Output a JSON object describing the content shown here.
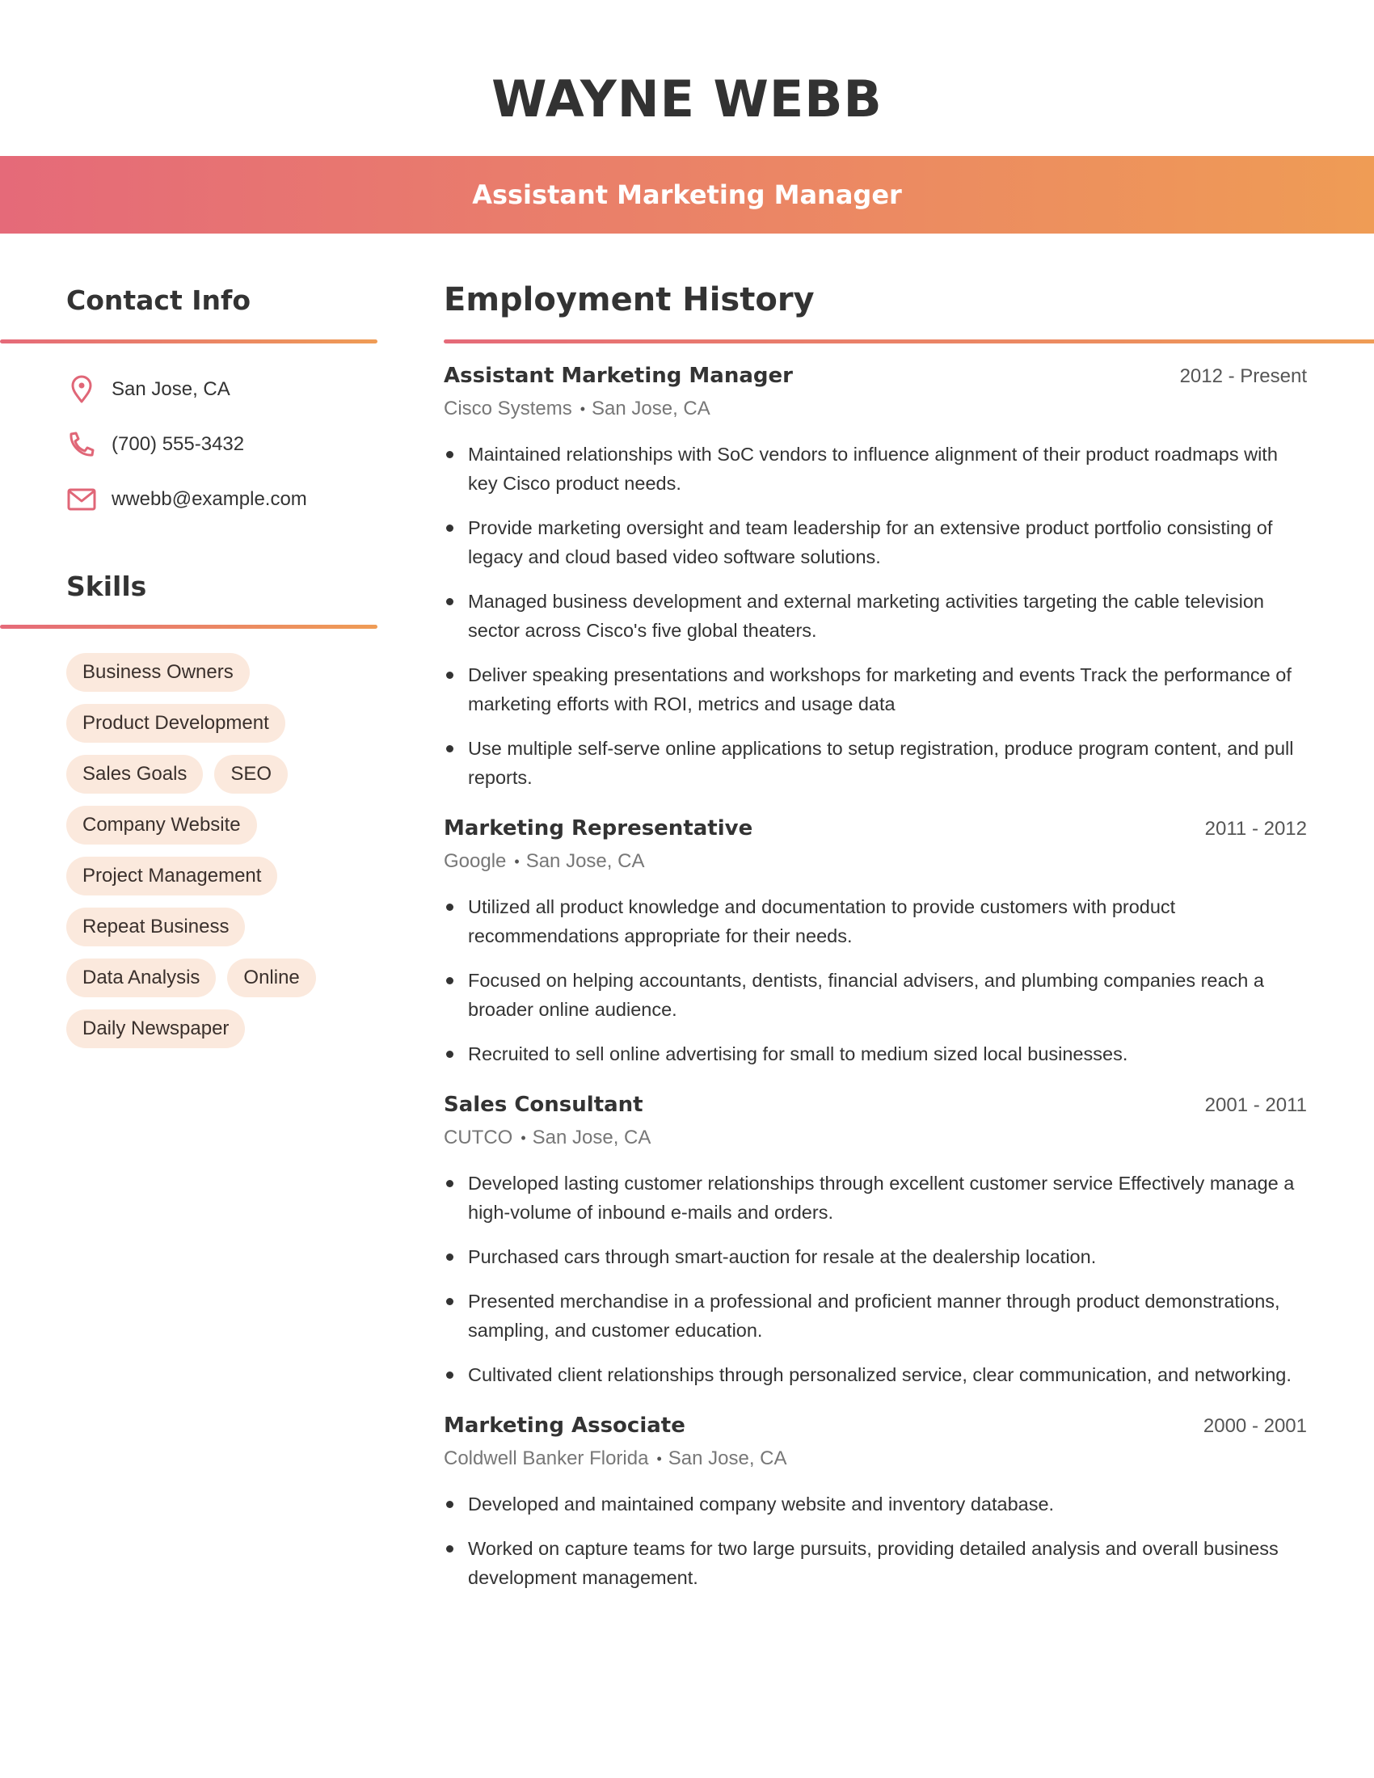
{
  "header": {
    "name": "WAYNE WEBB",
    "title": "Assistant Marketing Manager"
  },
  "colors": {
    "gradient_start": "#e56a79",
    "gradient_end": "#ef9c55",
    "icon": "#e06677",
    "chip_bg": "#fbe9dd",
    "text": "#333333"
  },
  "contact": {
    "heading": "Contact Info",
    "items": [
      {
        "icon": "location-pin-icon",
        "text": "San Jose, CA"
      },
      {
        "icon": "phone-icon",
        "text": "(700) 555-3432"
      },
      {
        "icon": "mail-icon",
        "text": "wwebb@example.com"
      }
    ]
  },
  "skills": {
    "heading": "Skills",
    "items": [
      "Business Owners",
      "Product Development",
      "Sales Goals",
      "SEO",
      "Company Website",
      "Project Management",
      "Repeat Business",
      "Data Analysis",
      "Online",
      "Daily Newspaper"
    ]
  },
  "employment": {
    "heading": "Employment History",
    "jobs": [
      {
        "title": "Assistant Marketing Manager",
        "dates": "2012 - Present",
        "company": "Cisco Systems",
        "location": "San Jose, CA",
        "bullets": [
          "Maintained relationships with SoC vendors to influence alignment of their product roadmaps with key Cisco product needs.",
          "Provide marketing oversight and team leadership for an extensive product portfolio consisting of legacy and cloud based video software solutions.",
          "Managed business development and external marketing activities targeting the cable television sector across Cisco's five global theaters.",
          "Deliver speaking presentations and workshops for marketing and events Track the performance of marketing efforts with ROI, metrics and usage data",
          "Use multiple self-serve online applications to setup registration, produce program content, and pull reports."
        ]
      },
      {
        "title": "Marketing Representative",
        "dates": "2011 - 2012",
        "company": "Google",
        "location": "San Jose, CA",
        "bullets": [
          "Utilized all product knowledge and documentation to provide customers with product recommendations appropriate for their needs.",
          "Focused on helping accountants, dentists, financial advisers, and plumbing companies reach a broader online audience.",
          "Recruited to sell online advertising for small to medium sized local businesses."
        ]
      },
      {
        "title": "Sales Consultant",
        "dates": "2001 - 2011",
        "company": "CUTCO",
        "location": "San Jose, CA",
        "bullets": [
          "Developed lasting customer relationships through excellent customer service Effectively manage a high-volume of inbound e-mails and orders.",
          "Purchased cars through smart-auction for resale at the dealership location.",
          "Presented merchandise in a professional and proficient manner through product demonstrations, sampling, and customer education.",
          "Cultivated client relationships through personalized service, clear communication, and networking."
        ]
      },
      {
        "title": "Marketing Associate",
        "dates": "2000 - 2001",
        "company": "Coldwell Banker Florida",
        "location": "San Jose, CA",
        "bullets": [
          "Developed and maintained company website and inventory database.",
          "Worked on capture teams for two large pursuits, providing detailed analysis and overall business development management."
        ]
      }
    ]
  }
}
